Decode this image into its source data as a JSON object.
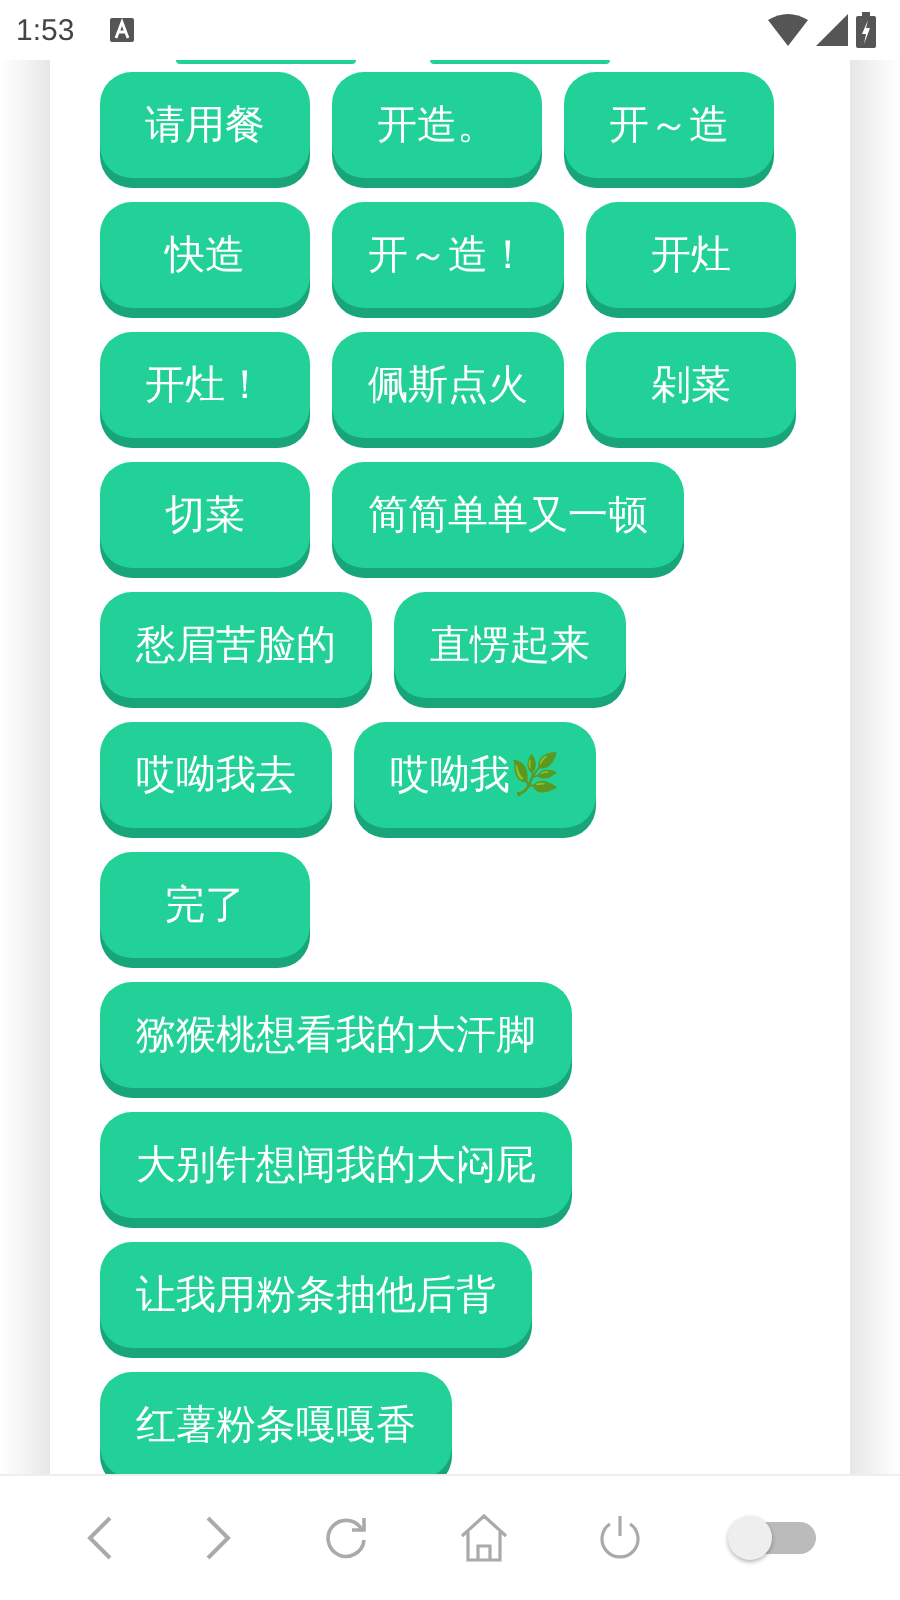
{
  "status_bar": {
    "time": "1:53"
  },
  "buttons": [
    "请用餐",
    "开造。",
    "开～造",
    "快造",
    "开～造！",
    "开灶",
    "开灶！",
    "佩斯点火",
    "剁菜",
    "切菜",
    "简简单单又一顿",
    "愁眉苦脸的",
    "直愣起来",
    "哎呦我去",
    "哎呦我🌿",
    "完了",
    "猕猴桃想看我的大汗脚",
    "大别针想闻我的大闷屁",
    "让我用粉条抽他后背",
    "红薯粉条嘎嘎香"
  ],
  "nav_bar": {
    "toggle_on": false
  }
}
